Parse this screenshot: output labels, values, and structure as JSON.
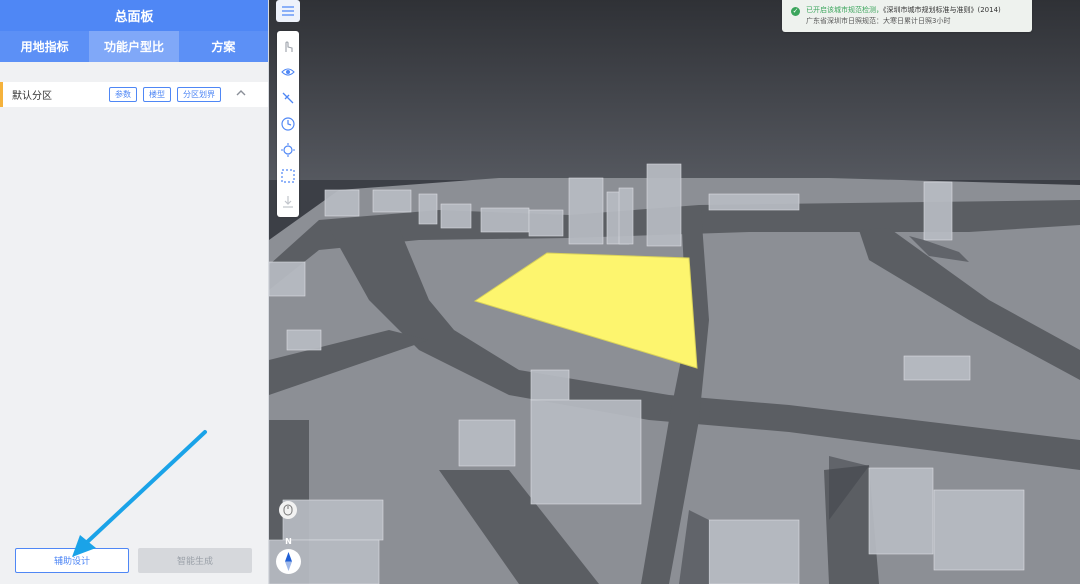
{
  "panel": {
    "title": "总面板",
    "tabs": [
      {
        "label": "用地指标"
      },
      {
        "label": "功能户型比"
      },
      {
        "label": "方案"
      }
    ],
    "active_tab_index": 1,
    "zone": {
      "label": "默认分区",
      "buttons": [
        "参数",
        "楼型",
        "分区划界"
      ],
      "toggle_icon": "chevron-up-icon"
    },
    "actions": {
      "assist_label": "辅助设计",
      "smart_label": "智能生成"
    }
  },
  "toolbar": {
    "menu_icon": "list-menu-icon",
    "tools": [
      "hand-pointer-icon",
      "eye-icon",
      "measure-icon",
      "clock-icon",
      "sun-icon",
      "dashed-select-icon",
      "download-icon"
    ]
  },
  "notice": {
    "line1_status": "已开启该城市规范检测，",
    "line1_rule": "《深圳市城市规划标准与准则》(2014)",
    "line2": "广东省深圳市日照规范：大寒日累计日照3小时"
  },
  "map": {
    "compass_label": "N",
    "highlight_color": "#fdf56e",
    "ground_color": "#8c8f95",
    "road_color": "#5b5e63",
    "sky_color": "#3c3f46"
  }
}
